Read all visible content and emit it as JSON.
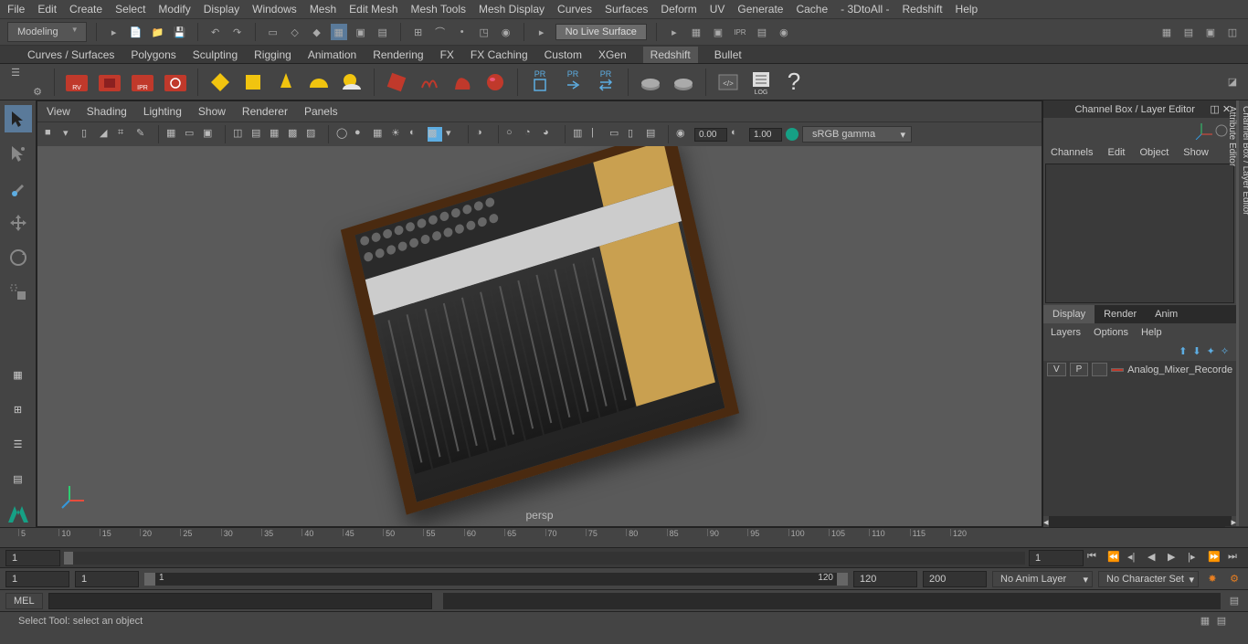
{
  "menu": [
    "File",
    "Edit",
    "Create",
    "Select",
    "Modify",
    "Display",
    "Windows",
    "Mesh",
    "Edit Mesh",
    "Mesh Tools",
    "Mesh Display",
    "Curves",
    "Surfaces",
    "Deform",
    "UV",
    "Generate",
    "Cache",
    "- 3DtoAll -",
    "Redshift",
    "Help"
  ],
  "workspace_mode": "Modeling",
  "no_live": "No Live Surface",
  "shelf_tabs": [
    "Curves / Surfaces",
    "Polygons",
    "Sculpting",
    "Rigging",
    "Animation",
    "Rendering",
    "FX",
    "FX Caching",
    "Custom",
    "XGen",
    "Redshift",
    "Bullet"
  ],
  "shelf_active": "Redshift",
  "shelf_rv_labels": [
    "RV",
    "",
    "IPR",
    ""
  ],
  "shelf_pr_labels": [
    "PR",
    "PR",
    "PR"
  ],
  "shelf_log": "LOG",
  "viewport_menu": [
    "View",
    "Shading",
    "Lighting",
    "Show",
    "Renderer",
    "Panels"
  ],
  "vp_num1": "0.00",
  "vp_num2": "1.00",
  "colorspace": "sRGB gamma",
  "viewport_camera": "persp",
  "right_panel_title": "Channel Box / Layer Editor",
  "right_side_tabs": [
    "Channel Box / Layer Editor",
    "Attribute Editor"
  ],
  "channel_tabs": [
    "Channels",
    "Edit",
    "Object",
    "Show"
  ],
  "layer_section_tabs": [
    "Display",
    "Render",
    "Anim"
  ],
  "layer_section_active": "Display",
  "layer_menu": [
    "Layers",
    "Options",
    "Help"
  ],
  "layer_item": {
    "vis": "V",
    "p": "P",
    "color": "#c0392b",
    "name": "Analog_Mixer_Recorde"
  },
  "timeline": {
    "start": 5,
    "end": 120,
    "step": 5,
    "current": "1",
    "range_end": "1"
  },
  "range": {
    "start": "1",
    "end": "1",
    "range_start_v": "1",
    "range_end_v": "120",
    "fps_start": "120",
    "fps_end": "200"
  },
  "anim_layer_dd": "No Anim Layer",
  "char_set_dd": "No Character Set",
  "cmd_lang": "MEL",
  "status_text": "Select Tool: select an object"
}
